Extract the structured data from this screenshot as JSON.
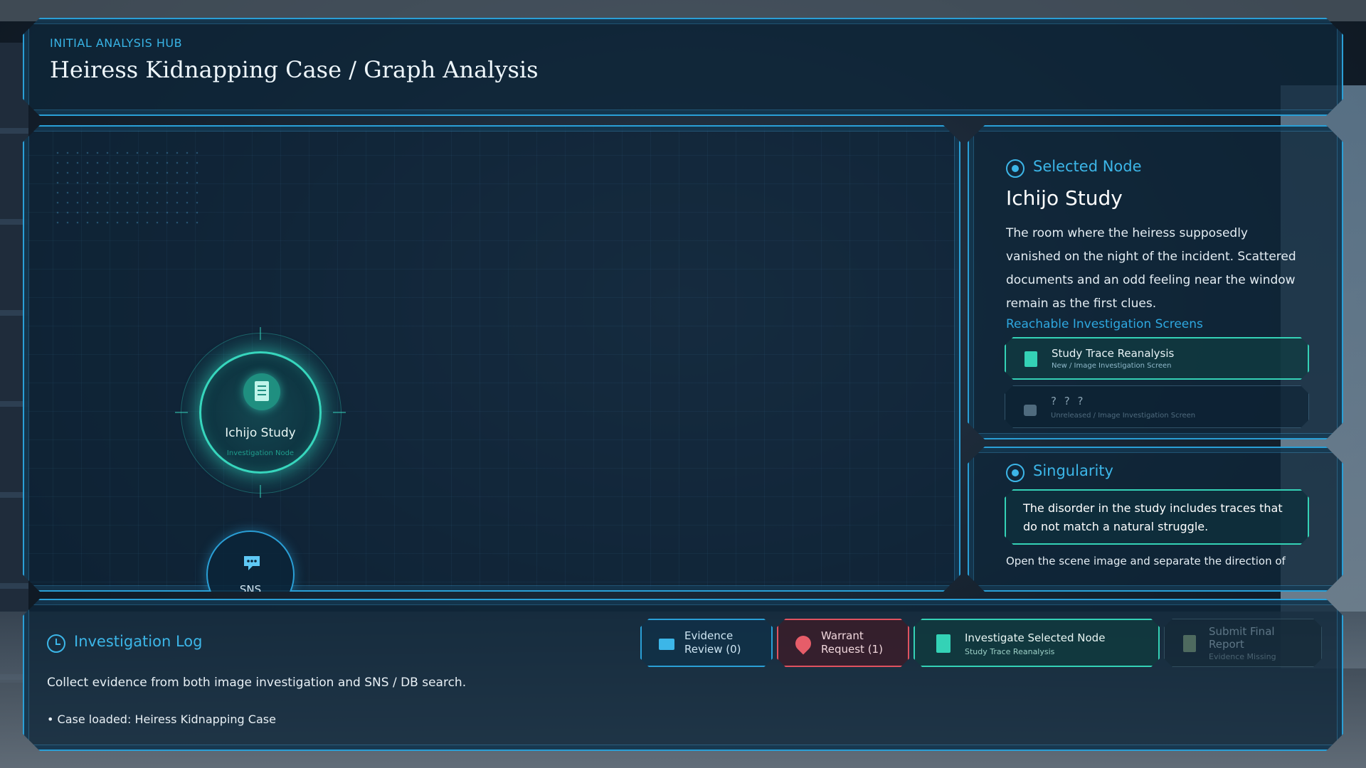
{
  "header": {
    "hub_label": "INITIAL ANALYSIS HUB",
    "title": "Heiress Kidnapping Case / Graph Analysis"
  },
  "graph": {
    "nodes": [
      {
        "label": "Ichijo Study",
        "sub": "Investigation Node",
        "icon": "document-icon",
        "state": "selected"
      },
      {
        "label": "SNS",
        "icon": "chat-icon",
        "state": "idle"
      }
    ]
  },
  "selected_node": {
    "heading": "Selected Node",
    "name": "Ichijo Study",
    "description": "The room where the heiress supposedly vanished on the night of the incident. Scattered documents and an odd feeling near the window remain as the first clues.",
    "reachable_heading": "Reachable Investigation Screens",
    "screens": [
      {
        "title": "Study Trace Reanalysis",
        "sub": "New / Image Investigation Screen",
        "icon": "document-icon",
        "locked": false
      },
      {
        "title": "? ? ?",
        "sub": "Unreleased / Image Investigation Screen",
        "icon": "lock-icon",
        "locked": true
      }
    ]
  },
  "singularity": {
    "heading": "Singularity",
    "highlight": "The disorder in the study includes traces that do not match a natural struggle.",
    "footer": "Open the scene image and separate the direction of"
  },
  "log": {
    "heading": "Investigation Log",
    "message": "Collect evidence from both image investigation and SNS / DB search.",
    "items": [
      "• Case loaded: Heiress Kidnapping Case"
    ]
  },
  "actions": {
    "evidence": {
      "line1": "Evidence",
      "line2": "Review (0)"
    },
    "warrant": {
      "line1": "Warrant",
      "line2": "Request (1)"
    },
    "investigate": {
      "label": "Investigate Selected Node",
      "sub": "Study Trace Reanalysis"
    },
    "submit": {
      "line1": "Submit Final",
      "line2": "Report",
      "sub": "Evidence Missing"
    }
  },
  "colors": {
    "accent_blue": "#2a9fd6",
    "accent_teal": "#34d2b6",
    "accent_red": "#e0525f"
  }
}
